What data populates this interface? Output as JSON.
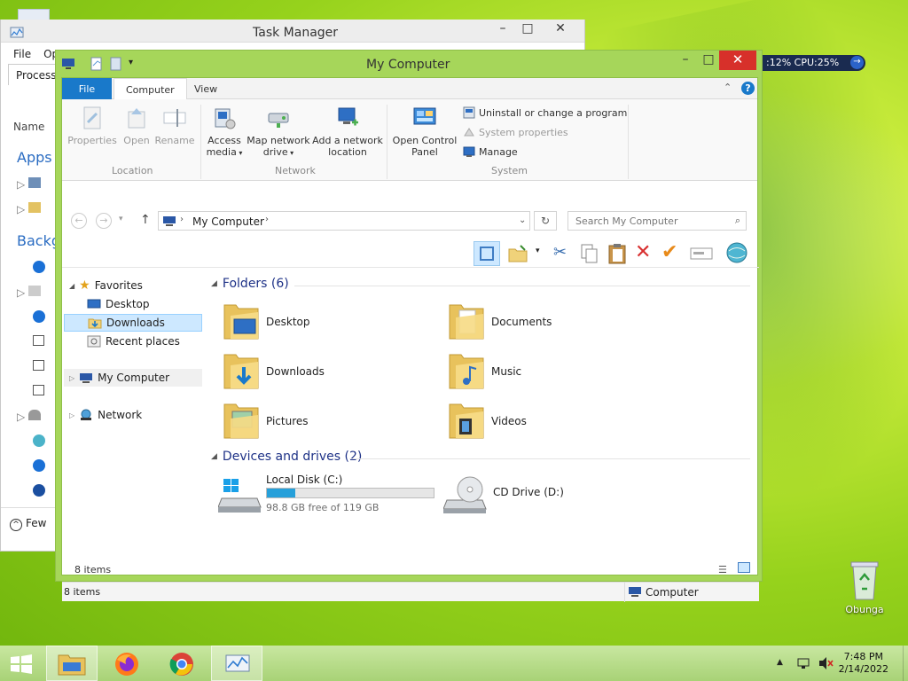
{
  "desktop": {
    "recycle_label": "Obunga",
    "cpu_gadget": ":12%  CPU:25%"
  },
  "task_manager": {
    "title": "Task Manager",
    "menu": [
      "File",
      "Op"
    ],
    "tab": "Processe",
    "column": "Name",
    "section_apps": "Apps (",
    "section_background": "Backg",
    "footer": "Few"
  },
  "my_computer": {
    "title": "My Computer",
    "tabs": {
      "file": "File",
      "computer": "Computer",
      "view": "View"
    },
    "ribbon": {
      "location": {
        "label": "Location",
        "properties": "Properties",
        "open": "Open",
        "rename": "Rename"
      },
      "network": {
        "label": "Network",
        "access_media": "Access media",
        "map_network_drive": "Map network drive",
        "add_network_location": "Add a network location"
      },
      "system": {
        "label": "System",
        "open_control_panel": "Open Control Panel",
        "uninstall": "Uninstall or change a program",
        "system_properties": "System properties",
        "manage": "Manage"
      }
    },
    "address": {
      "path": "My Computer"
    },
    "search": {
      "placeholder": "Search My Computer"
    },
    "nav": {
      "favorites": "Favorites",
      "desktop": "Desktop",
      "downloads": "Downloads",
      "recent_places": "Recent places",
      "my_computer": "My Computer",
      "network": "Network"
    },
    "folders_header": "Folders (6)",
    "folders": [
      {
        "name": "Desktop"
      },
      {
        "name": "Documents"
      },
      {
        "name": "Downloads"
      },
      {
        "name": "Music"
      },
      {
        "name": "Pictures"
      },
      {
        "name": "Videos"
      }
    ],
    "devices_header": "Devices and drives (2)",
    "local_disk": {
      "name": "Local Disk (C:)",
      "free": "98.8 GB free of 119 GB",
      "used_fraction": 0.17
    },
    "cd_drive": {
      "name": "CD Drive (D:)"
    },
    "status_items": "8 items",
    "status_bar_items": "8 items",
    "status_bar_location": "Computer"
  },
  "taskbar": {
    "time": "7:48 PM",
    "date": "2/14/2022"
  },
  "colors": {
    "accent": "#1979ca",
    "window_frame": "#a6d65a",
    "close": "#d7302a"
  }
}
